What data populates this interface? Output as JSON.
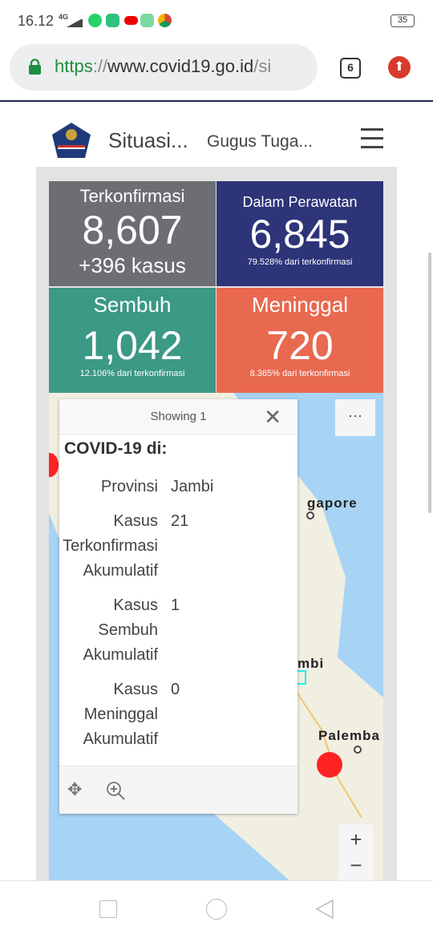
{
  "status_bar": {
    "time": "16.12",
    "network": "4G",
    "battery": "35"
  },
  "browser": {
    "url_scheme": "https",
    "url_sep": "://",
    "url_host": "www.covid19.go.id",
    "url_path": "/si",
    "tab_count": "6"
  },
  "header": {
    "title": "Situasi...",
    "subtitle": "Gugus Tuga..."
  },
  "stats": [
    {
      "label": "Terkonfirmasi",
      "value": "8,607",
      "sub": "+396 kasus",
      "color": "#6d6e73"
    },
    {
      "label": "Dalam Perawatan",
      "value": "6,845",
      "sub": "79.528% dari terkonfirmasi",
      "color": "#2d3478"
    },
    {
      "label": "Sembuh",
      "value": "1,042",
      "sub": "12.106% dari terkonfirmasi",
      "color": "#3b9985"
    },
    {
      "label": "Meninggal",
      "value": "720",
      "sub": "8.365% dari terkonfirmasi",
      "color": "#e8694f"
    }
  ],
  "popup": {
    "header": "Showing 1",
    "title": "COVID-19 di:",
    "rows": [
      {
        "key": "Provinsi",
        "value": "Jambi"
      },
      {
        "key": "Kasus Terkonfirmasi Akumulatif",
        "value": "21"
      },
      {
        "key": "Kasus Sembuh Akumulatif",
        "value": "1"
      },
      {
        "key": "Kasus Meninggal Akumulatif",
        "value": "0"
      }
    ]
  },
  "map": {
    "labels": {
      "singapore": "gapore",
      "jambi": "mbi",
      "palembang": "Palemba"
    },
    "more": "···",
    "zoom_in": "+",
    "zoom_out": "−"
  }
}
